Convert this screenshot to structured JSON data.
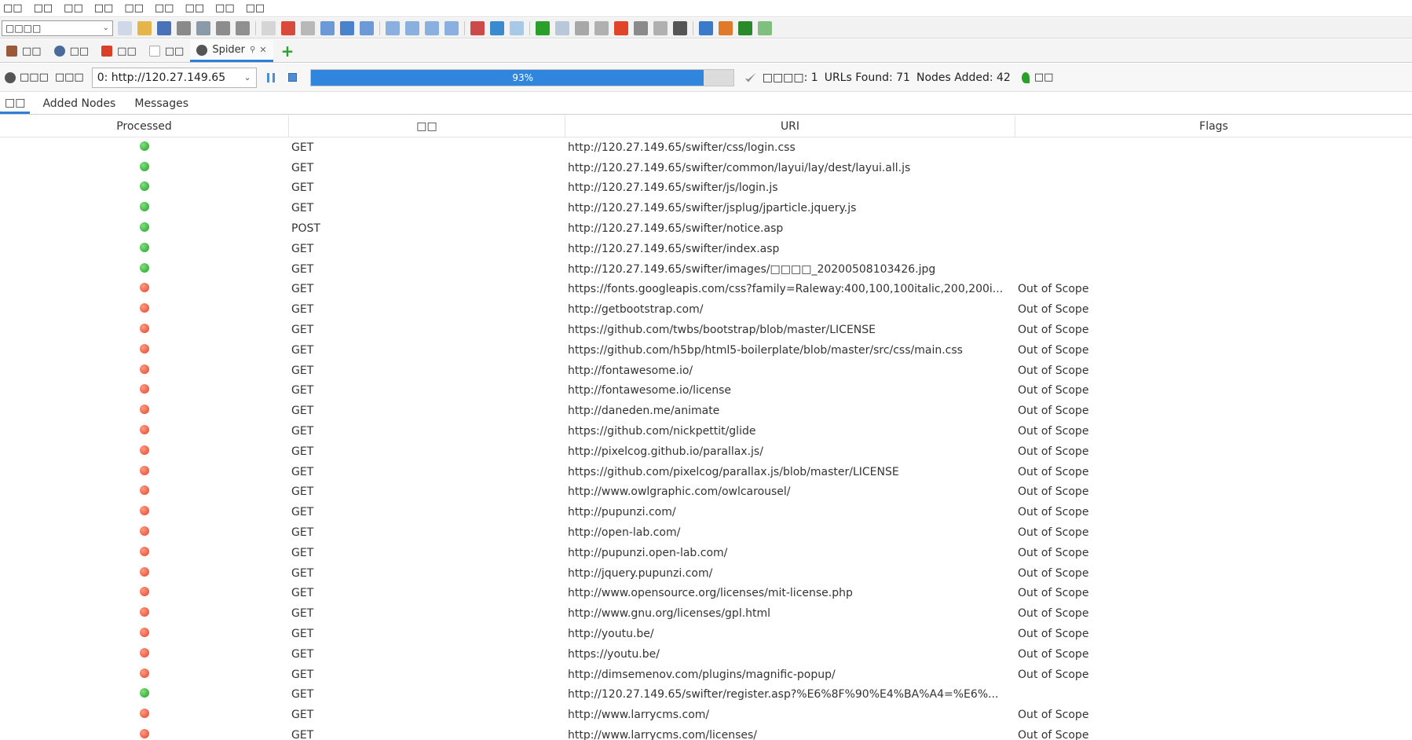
{
  "menubar": {
    "items": [
      "□□",
      "□□",
      "□□",
      "□□",
      "□□",
      "□□",
      "□□",
      "□□",
      "□□"
    ]
  },
  "toolbar": {
    "mode_value": "□□□□",
    "icons": [
      {
        "name": "new-session-icon",
        "color": "#cfd8e6"
      },
      {
        "name": "open-session-icon",
        "color": "#e6b54a"
      },
      {
        "name": "save-session-icon",
        "color": "#4a72b8"
      },
      {
        "name": "snapshot-icon",
        "color": "#8a8a8a"
      },
      {
        "name": "session-properties-icon",
        "color": "#8a9aa8"
      },
      {
        "name": "options-gear-icon",
        "color": "#8c8c8c"
      },
      {
        "name": "export-icon",
        "color": "#909090"
      },
      {
        "name": "separator"
      },
      {
        "name": "new-context-icon",
        "color": "#d5d5d5"
      },
      {
        "name": "delete-icon",
        "color": "#d84a3a"
      },
      {
        "name": "layout-full-icon",
        "color": "#b8b8b8"
      },
      {
        "name": "layout-left-icon",
        "color": "#6b9ad6"
      },
      {
        "name": "layout-bottom-icon",
        "color": "#4a82cc"
      },
      {
        "name": "layout-tabs-icon",
        "color": "#6b9ad6"
      },
      {
        "name": "separator"
      },
      {
        "name": "show-tabs-icon",
        "color": "#8ab0e0"
      },
      {
        "name": "expand-sites-icon",
        "color": "#8ab0e0"
      },
      {
        "name": "expand-info-icon",
        "color": "#8ab0e0"
      },
      {
        "name": "expand-full-icon",
        "color": "#8ab0e0"
      },
      {
        "name": "separator"
      },
      {
        "name": "scan-policy-icon",
        "color": "#cc4a4a"
      },
      {
        "name": "globe-icon",
        "color": "#3a8ad0"
      },
      {
        "name": "lightbulb-icon",
        "color": "#a8c8e8"
      },
      {
        "name": "separator"
      },
      {
        "name": "break-on-icon",
        "color": "#2aa02a"
      },
      {
        "name": "step-icon",
        "color": "#b8c8d8"
      },
      {
        "name": "continue-icon",
        "color": "#a8a8a8"
      },
      {
        "name": "drop-icon",
        "color": "#b0b0b0"
      },
      {
        "name": "cancel-x-icon",
        "color": "#e0452a"
      },
      {
        "name": "manual-request-icon",
        "color": "#8a8a8a"
      },
      {
        "name": "scripts-icon",
        "color": "#b0b0b0"
      },
      {
        "name": "console-icon",
        "color": "#555555"
      },
      {
        "name": "separator"
      },
      {
        "name": "help-icon",
        "color": "#3a7ac8"
      },
      {
        "name": "browser-icon",
        "color": "#e07a2a"
      },
      {
        "name": "hud-icon",
        "color": "#2a8a2a"
      },
      {
        "name": "notes-icon",
        "color": "#7fc07f"
      }
    ]
  },
  "tabs": [
    {
      "label": "□□",
      "icon": "history-icon",
      "icon_color": "#9a5a3a",
      "active": false
    },
    {
      "label": "□□",
      "icon": "search-icon",
      "icon_color": "#4a6a9a",
      "active": false
    },
    {
      "label": "□□",
      "icon": "alerts-flag-icon",
      "icon_color": "#d8402a",
      "active": false
    },
    {
      "label": "□□",
      "icon": "output-icon",
      "icon_color": "#b0b0b0",
      "active": false
    },
    {
      "label": "Spider",
      "icon": "spider-icon",
      "icon_color": "#555555",
      "active": true
    }
  ],
  "spider": {
    "new_scan_label": "□□□",
    "progress_label": "□□□",
    "scan_select": "0: http://120.27.149.65",
    "progress_percent": 93,
    "progress_text": "93%",
    "stats": {
      "current_scans": "□□□□: 1",
      "urls_found": "URLs Found: 71",
      "nodes_added": "Nodes Added: 42"
    },
    "export_label": "□□"
  },
  "subtabs": [
    {
      "label": "□□",
      "active": true
    },
    {
      "label": "Added Nodes",
      "active": false
    },
    {
      "label": "Messages",
      "active": false
    }
  ],
  "table": {
    "headers": [
      "Processed",
      "□□",
      "URI",
      "Flags"
    ],
    "rows": [
      {
        "ok": true,
        "method": "GET",
        "uri": "http://120.27.149.65/swifter/css/login.css",
        "flags": ""
      },
      {
        "ok": true,
        "method": "GET",
        "uri": "http://120.27.149.65/swifter/common/layui/lay/dest/layui.all.js",
        "flags": ""
      },
      {
        "ok": true,
        "method": "GET",
        "uri": "http://120.27.149.65/swifter/js/login.js",
        "flags": ""
      },
      {
        "ok": true,
        "method": "GET",
        "uri": "http://120.27.149.65/swifter/jsplug/jparticle.jquery.js",
        "flags": ""
      },
      {
        "ok": true,
        "method": "POST",
        "uri": "http://120.27.149.65/swifter/notice.asp",
        "flags": ""
      },
      {
        "ok": true,
        "method": "GET",
        "uri": "http://120.27.149.65/swifter/index.asp",
        "flags": ""
      },
      {
        "ok": true,
        "method": "GET",
        "uri": "http://120.27.149.65/swifter/images/□□□□_20200508103426.jpg",
        "flags": ""
      },
      {
        "ok": false,
        "method": "GET",
        "uri": "https://fonts.googleapis.com/css?family=Raleway:400,100,100italic,200,200i...",
        "flags": "Out of Scope"
      },
      {
        "ok": false,
        "method": "GET",
        "uri": "http://getbootstrap.com/",
        "flags": "Out of Scope"
      },
      {
        "ok": false,
        "method": "GET",
        "uri": "https://github.com/twbs/bootstrap/blob/master/LICENSE",
        "flags": "Out of Scope"
      },
      {
        "ok": false,
        "method": "GET",
        "uri": "https://github.com/h5bp/html5-boilerplate/blob/master/src/css/main.css",
        "flags": "Out of Scope"
      },
      {
        "ok": false,
        "method": "GET",
        "uri": "http://fontawesome.io/",
        "flags": "Out of Scope"
      },
      {
        "ok": false,
        "method": "GET",
        "uri": "http://fontawesome.io/license",
        "flags": "Out of Scope"
      },
      {
        "ok": false,
        "method": "GET",
        "uri": "http://daneden.me/animate",
        "flags": "Out of Scope"
      },
      {
        "ok": false,
        "method": "GET",
        "uri": "https://github.com/nickpettit/glide",
        "flags": "Out of Scope"
      },
      {
        "ok": false,
        "method": "GET",
        "uri": "http://pixelcog.github.io/parallax.js/",
        "flags": "Out of Scope"
      },
      {
        "ok": false,
        "method": "GET",
        "uri": "https://github.com/pixelcog/parallax.js/blob/master/LICENSE",
        "flags": "Out of Scope"
      },
      {
        "ok": false,
        "method": "GET",
        "uri": "http://www.owlgraphic.com/owlcarousel/",
        "flags": "Out of Scope"
      },
      {
        "ok": false,
        "method": "GET",
        "uri": "http://pupunzi.com/",
        "flags": "Out of Scope"
      },
      {
        "ok": false,
        "method": "GET",
        "uri": "http://open-lab.com/",
        "flags": "Out of Scope"
      },
      {
        "ok": false,
        "method": "GET",
        "uri": "http://pupunzi.open-lab.com/",
        "flags": "Out of Scope"
      },
      {
        "ok": false,
        "method": "GET",
        "uri": "http://jquery.pupunzi.com/",
        "flags": "Out of Scope"
      },
      {
        "ok": false,
        "method": "GET",
        "uri": "http://www.opensource.org/licenses/mit-license.php",
        "flags": "Out of Scope"
      },
      {
        "ok": false,
        "method": "GET",
        "uri": "http://www.gnu.org/licenses/gpl.html",
        "flags": "Out of Scope"
      },
      {
        "ok": false,
        "method": "GET",
        "uri": "http://youtu.be/",
        "flags": "Out of Scope"
      },
      {
        "ok": false,
        "method": "GET",
        "uri": "https://youtu.be/",
        "flags": "Out of Scope"
      },
      {
        "ok": false,
        "method": "GET",
        "uri": "http://dimsemenov.com/plugins/magnific-popup/",
        "flags": "Out of Scope"
      },
      {
        "ok": true,
        "method": "GET",
        "uri": "http://120.27.149.65/swifter/register.asp?%E6%8F%90%E4%BA%A4=%E6%...",
        "flags": ""
      },
      {
        "ok": false,
        "method": "GET",
        "uri": "http://www.larrycms.com/",
        "flags": "Out of Scope"
      },
      {
        "ok": false,
        "method": "GET",
        "uri": "http://www.larrycms.com/licenses/",
        "flags": "Out of Scope"
      }
    ]
  }
}
